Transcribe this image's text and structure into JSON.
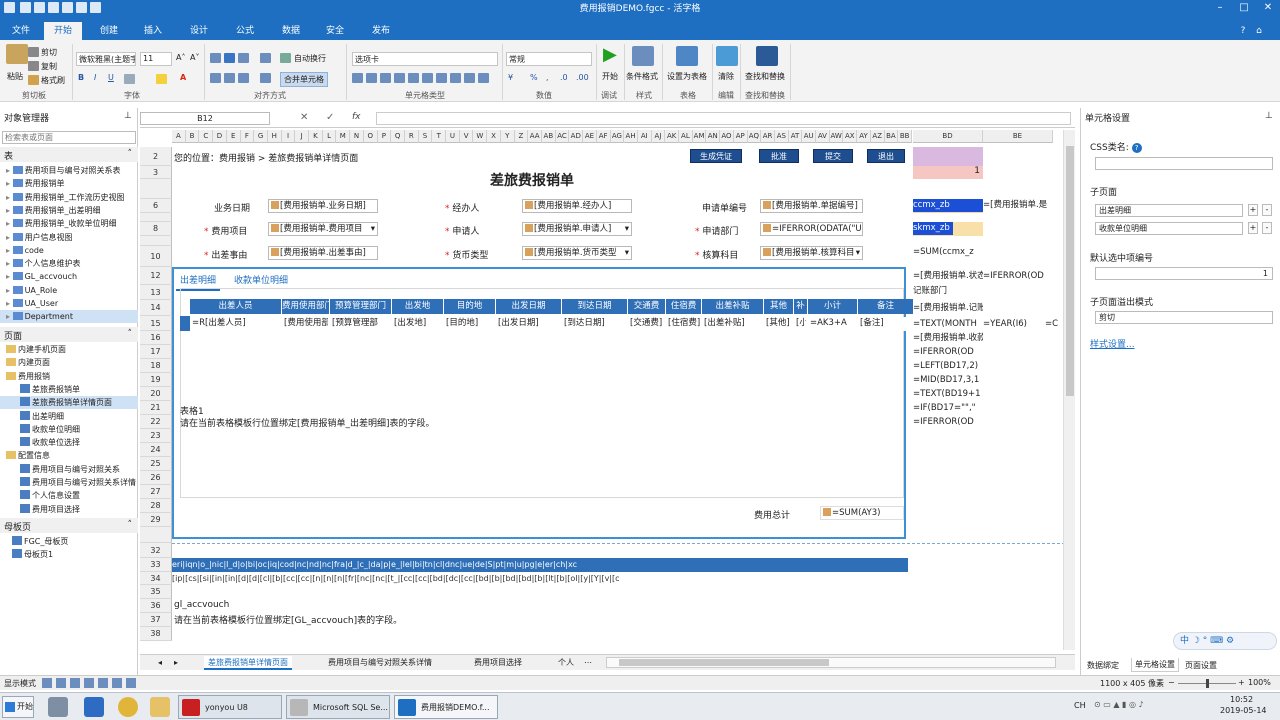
{
  "window": {
    "title": "费用报销DEMO.fgcc - 活字格"
  },
  "ribbon_tabs": [
    "文件",
    "开始",
    "创建",
    "插入",
    "设计",
    "公式",
    "数据",
    "安全",
    "发布"
  ],
  "ribbon": {
    "clipboard": {
      "paste": "粘贴",
      "cut": "剪切",
      "copy": "复制",
      "format_painter": "格式刷",
      "group": "剪切板"
    },
    "font": {
      "font_name": "微软雅黑(主题字",
      "font_size": "11",
      "bold": "B",
      "italic": "I",
      "underline": "U",
      "group": "字体"
    },
    "align": {
      "wrap": "自动换行",
      "merge": "合并单元格",
      "group": "对齐方式"
    },
    "cell_type": {
      "combo": "选项卡",
      "group": "单元格类型"
    },
    "number": {
      "format": "常规",
      "group": "数值"
    },
    "debug": {
      "start": "开始",
      "group": "调试"
    },
    "style": {
      "cond": "条件格式",
      "group": "样式"
    },
    "table": {
      "set_table": "设置为表格",
      "group": "表格"
    },
    "edit": {
      "clear": "清除",
      "group": "编辑"
    },
    "find": {
      "find_replace": "查找和替换",
      "group": "查找和替换"
    }
  },
  "left_pane": {
    "title": "对象管理器",
    "search_placeholder": "检索表或页面",
    "tables_header": "表",
    "tables": [
      "费用项目与编号对照关系表",
      "费用报销单",
      "费用报销单_工作流历史视图",
      "费用报销单_出差明细",
      "费用报销单_收款单位明细",
      "用户信息视图",
      "code",
      "个人信息维护表",
      "GL_accvouch",
      "UA_Role",
      "UA_User",
      "Department"
    ],
    "pages_header": "页面",
    "pages": [
      {
        "label": "内建手机页面",
        "level": 0
      },
      {
        "label": "内建页面",
        "level": 0
      },
      {
        "label": "费用报销",
        "level": 0
      },
      {
        "label": "差旅费报销单",
        "level": 1
      },
      {
        "label": "差旅费报销单详情页面",
        "level": 1
      },
      {
        "label": "出差明细",
        "level": 1
      },
      {
        "label": "收款单位明细",
        "level": 1
      },
      {
        "label": "收款单位选择",
        "level": 1
      },
      {
        "label": "配置信息",
        "level": 0
      },
      {
        "label": "费用项目与编号对照关系",
        "level": 1
      },
      {
        "label": "费用项目与编号对照关系详情",
        "level": 1
      },
      {
        "label": "个人信息设置",
        "level": 1
      },
      {
        "label": "费用项目选择",
        "level": 1
      }
    ],
    "master_header": "母板页",
    "masters": [
      "FGC_母板页",
      "母板页1"
    ]
  },
  "formula_bar": {
    "cell_ref": "B12",
    "fx": "fx"
  },
  "columns": [
    "A",
    "B",
    "C",
    "D",
    "E",
    "F",
    "G",
    "H",
    "I",
    "J",
    "K",
    "L",
    "M",
    "N",
    "O",
    "P",
    "Q",
    "R",
    "S",
    "T",
    "U",
    "V",
    "W",
    "X",
    "Y",
    "Z",
    "AA",
    "AB",
    "AC",
    "AD",
    "AE",
    "AF",
    "AG",
    "AH",
    "AI",
    "AJ",
    "AK",
    "AL",
    "AM",
    "AN",
    "AO",
    "AP",
    "AQ",
    "AR",
    "AS",
    "AT",
    "AU",
    "AV",
    "AW",
    "AX",
    "AY",
    "AZ",
    "BA",
    "BB"
  ],
  "right_cols": [
    "BD",
    "BE"
  ],
  "rows": [
    "2",
    "3",
    "",
    "6",
    "",
    "8",
    "",
    "10",
    "12",
    "13",
    "14",
    "15",
    "16",
    "17",
    "18",
    "19",
    "20",
    "21",
    "22",
    "23",
    "24",
    "25",
    "26",
    "27",
    "28",
    "29",
    "",
    "32",
    "33",
    "34",
    "35",
    "36",
    "37",
    "38"
  ],
  "sheet": {
    "breadcrumb": "您的位置：费用报销 > 差旅费报销单详情页面",
    "buttons": [
      "生成凭证",
      "批准",
      "提交",
      "退出"
    ],
    "title": "差旅费报销单",
    "labels": {
      "biz_date": "业务日期",
      "handler": "经办人",
      "apply_no": "申请单编号",
      "fee_item": "费用项目",
      "applicant": "申请人",
      "dept": "申请部门",
      "reason": "出差事由",
      "currency": "货币类型",
      "account": "核算科目"
    },
    "values": {
      "biz_date": "[费用报销单.业务日期]",
      "handler": "[费用报销单.经办人]",
      "apply_no": "[费用报销单.单据编号]",
      "fee_item": "[费用报销单.费用项目",
      "applicant": "[费用报销单.申请人]",
      "dept": "=IFERROR(ODATA(\"U",
      "reason": "[费用报销单.出差事由]",
      "currency": "[费用报销单.货币类型",
      "account": "[费用报销单.核算科目"
    },
    "subtabs": [
      "出差明细",
      "收款单位明细"
    ],
    "table_headers": [
      "出差人员",
      "费用使用部门",
      "预算管理部门",
      "出发地",
      "目的地",
      "出发日期",
      "到达日期",
      "交通费",
      "住宿费",
      "出差补贴",
      "其他",
      "补",
      "小计",
      "备注"
    ],
    "table_row": [
      "=R[出差人员]",
      "[费用使用部",
      "[预算管理部",
      "[出发地]",
      "[目的地]",
      "[出发日期]",
      "[到达日期]",
      "[交通费]",
      "[住宿费]",
      "[出差补贴]",
      "[其他]",
      "[小",
      "=AK3+A",
      "[备注]"
    ],
    "table_note_title": "表格1",
    "table_note": "请在当前表格模板行位置绑定[费用报销单_出差明细]表的字段。",
    "total_label": "费用总计",
    "total_value": "=SUM(AY3)",
    "gl_header_row": "eri|iqn|o_|nic|l_d|o|bi|oc|iq|cod|nc|nd|nc|fra|d_|c_|da|p|e_|lel|bi|tn|cl|dnc|ue|de|S|pt|m|u|pg|e|er|ch|xc",
    "gl_value_row": "[ip|[cs|[si|[in|[in|[d|[d|[cl|[b|[cc|[cc|[n|[n|[n|[fr|[nc|[nc|[t_|[cc|[cc|[bd|[dc|[cc|[bd|[b|[bd|[bd|[b|[lt|[b|[ol|[y|[Y|[v|[c",
    "gl_title": "gl_accvouch",
    "gl_note": "请在当前表格模板行位置绑定[GL_accvouch]表的字段。",
    "side_cells": [
      "ccmx_zb",
      "=[费用报销单.是",
      "skmx_zb",
      "=SUM(ccmx_z",
      "=[费用报销单.状态",
      "=IFERROR(OD",
      "记账部门",
      "=[费用报销单.记账",
      "=TEXT(MONTH",
      "=YEAR(I6)",
      "=C",
      "=[费用报销单.收款",
      "=IFERROR(OD",
      "=LEFT(BD17,2)",
      "=MID(BD17,3,1",
      "=TEXT(BD19+1",
      "=IF(BD17=\"\",\"",
      "=IFERROR(OD"
    ],
    "side_one": "1"
  },
  "right_pane": {
    "title": "单元格设置",
    "css_label": "CSS类名:",
    "subpage_label": "子页面",
    "subpage_1": "出差明细",
    "subpage_2": "收款单位明细",
    "default_label": "默认选中项编号",
    "default_value": "1",
    "overflow_label": "子页面溢出模式",
    "overflow_value": "剪切",
    "style_link": "样式设置..."
  },
  "right_bottom_tabs": [
    "数据绑定",
    "单元格设置",
    "页面设置"
  ],
  "sheet_tabs": [
    "差旅费报销单详情页面",
    "费用项目与编号对照关系详情",
    "费用项目选择",
    "个人"
  ],
  "status": {
    "mode": "显示模式",
    "size": "1100 x 405 像素",
    "zoom": "100%"
  },
  "taskbar": {
    "start": "开始",
    "items": [
      "yonyou U8",
      "Microsoft SQL Se...",
      "费用报销DEMO.f..."
    ],
    "lang": "CH",
    "time": "10:52",
    "date": "2019-05-14"
  },
  "colors": {
    "brand": "#1e6fc2",
    "header_blue": "#2f6fb7",
    "selection": "#1a4fd6"
  }
}
